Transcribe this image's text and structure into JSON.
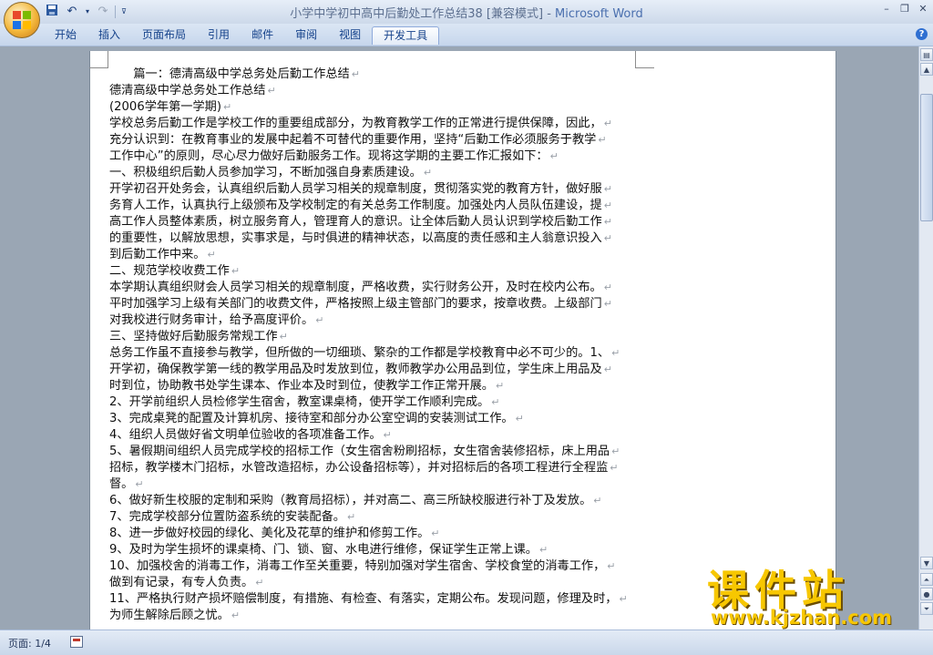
{
  "window": {
    "title": "小学中学初中高中后勤处工作总结38 [兼容模式]",
    "app_name": "Microsoft Word"
  },
  "qat": {
    "save": "save-icon",
    "undo": "undo-icon",
    "redo": "redo-icon",
    "customize": "customize-icon"
  },
  "ribbon": {
    "tabs": [
      "开始",
      "插入",
      "页面布局",
      "引用",
      "邮件",
      "审阅",
      "视图",
      "开发工具"
    ],
    "active_tab": "开发工具"
  },
  "document": {
    "lines": [
      "　　篇一：德清高级中学总务处后勤工作总结",
      "德清高级中学总务处工作总结",
      "(2006学年第一学期)",
      " 学校总务后勤工作是学校工作的重要组成部分，为教育教学工作的正常进行提供保障，因此，",
      "充分认识到：在教育事业的发展中起着不可替代的重要作用，坚持“后勤工作必须服务于教学",
      "工作中心”的原则，尽心尽力做好后勤服务工作。现将这学期的主要工作汇报如下：",
      "一、积极组织后勤人员参加学习，不断加强自身素质建设。",
      "开学初召开处务会，认真组织后勤人员学习相关的规章制度，贯彻落实党的教育方针，做好服",
      "务育人工作，认真执行上级颁布及学校制定的有关总务工作制度。加强处内人员队伍建设，提",
      "高工作人员整体素质，树立服务育人，管理育人的意识。让全体后勤人员认识到学校后勤工作",
      "的重要性，以解放思想，实事求是，与时俱进的精神状态，以高度的责任感和主人翁意识投入",
      "到后勤工作中来。",
      "二、规范学校收费工作",
      "本学期认真组织财会人员学习相关的规章制度，严格收费，实行财务公开，及时在校内公布。",
      "平时加强学习上级有关部门的收费文件，严格按照上级主管部门的要求，按章收费。上级部门",
      "对我校进行财务审计，给予高度评价。",
      "三、坚持做好后勤服务常规工作",
      "总务工作虽不直接参与教学，但所做的一切细琐、繁杂的工作都是学校教育中必不可少的。1、",
      "开学初，确保教学第一线的教学用品及时发放到位，教师教学办公用品到位，学生床上用品及",
      "时到位，协助教书处学生课本、作业本及时到位，使教学工作正常开展。",
      "2、开学前组织人员检修学生宿舍，教室课桌椅，使开学工作顺利完成。",
      "3、完成桌凳的配置及计算机房、接待室和部分办公室空调的安装测试工作。",
      "4、组织人员做好省文明单位验收的各项准备工作。",
      "5、暑假期间组织人员完成学校的招标工作（女生宿舍粉刷招标，女生宿舍装修招标，床上用品",
      "招标，教学楼木门招标，水管改造招标，办公设备招标等），并对招标后的各项工程进行全程监",
      "督。",
      "6、做好新生校服的定制和采购（教育局招标），并对高二、高三所缺校服进行补丁及发放。",
      "7、完成学校部分位置防盗系统的安装配备。",
      "8、进一步做好校园的绿化、美化及花草的维护和修剪工作。",
      "9、及时为学生损坏的课桌椅、门、锁、窗、水电进行维修，保证学生正常上课。",
      "10、加强校舍的消毒工作，消毒工作至关重要，特别加强对学生宿舍、学校食堂的消毒工作，",
      "做到有记录，有专人负责。",
      "11、严格执行财产损坏赔偿制度，有措施、有检查、有落实，定期公布。发现问题，修理及时，",
      "为师生解除后顾之忧。"
    ],
    "pilcrow": "↵"
  },
  "statusbar": {
    "page_info": "页面: 1/4"
  },
  "watermark": {
    "brand": "课件站",
    "url": "www.kjzhan.com"
  },
  "colors": {
    "accent": "#15428b",
    "watermark": "#f7c700"
  }
}
